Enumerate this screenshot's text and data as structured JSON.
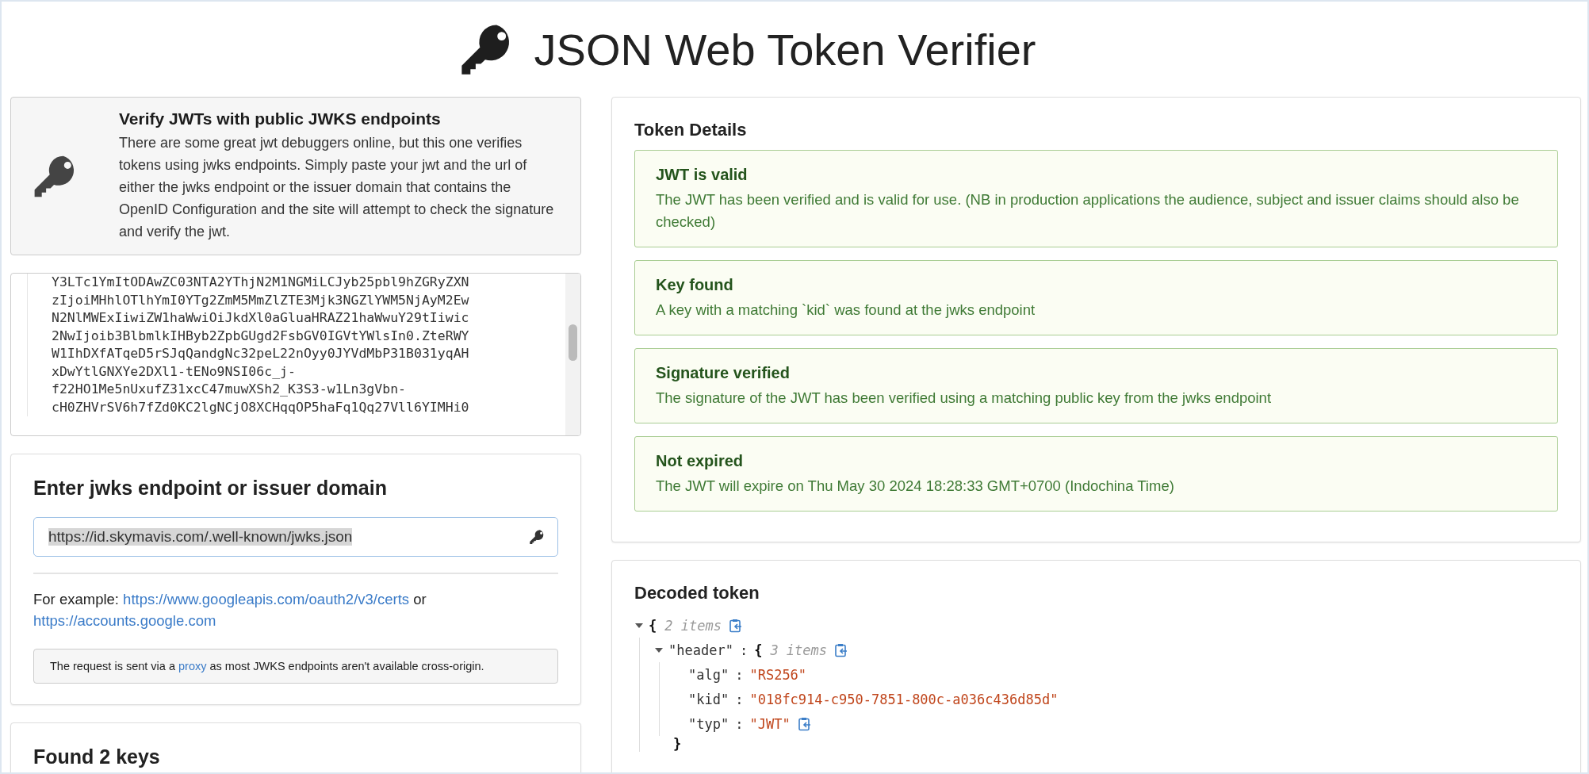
{
  "header": {
    "title": "JSON Web Token Verifier"
  },
  "intro": {
    "title": "Verify JWTs with public JWKS endpoints",
    "text": "There are some great jwt debuggers online, but this one verifies tokens using jwks endpoints. Simply paste your jwt and the url of either the jwks endpoint or the issuer domain that contains the OpenID Configuration and the site will attempt to check the signature and verify the jwt."
  },
  "token_input": {
    "lines": [
      "Y3LTc1YmItODAwZC03NTA2YThjN2M1NGMiLCJyb25pbl9hZGRyZXN",
      "zIjoiMHhlOTlhYmI0YTg2ZmM5MmZlZTE3Mjk3NGZlYWM5NjAyM2Ew",
      "N2NlMWExIiwiZW1haWwiOiJkdXl0aGluaHRAZ21haWwuY29tIiwic",
      "2NwIjoib3BlbmlkIHByb2ZpbGUgd2FsbGV0IGVtYWlsIn0.ZteRWY",
      "W1IhDXfATqeD5rSJqQandgNc32peL22nOyy0JYVdMbP31B031yqAH",
      "xDwYtlGNXYe2DXl1-tENo9NSI06c_j-",
      "f22HO1Me5nUxufZ31xcC47muwXSh2_K3S3-w1Ln3gVbn-",
      "cH0ZHVrSV6h7fZd0KC2lgNCjO8XCHqqOP5haFq1Qq27Vll6YIMHi0"
    ]
  },
  "jwks": {
    "title": "Enter jwks endpoint or issuer domain",
    "value": "https://id.skymavis.com/.well-known/jwks.json",
    "value_selected": true,
    "example": [
      {
        "kind": "text",
        "text": "For example: "
      },
      {
        "kind": "link",
        "text": "https://www.googleapis.com/oauth2/v3/certs"
      },
      {
        "kind": "text",
        "text": " or "
      },
      {
        "kind": "link",
        "text": "https://accounts.google.com"
      }
    ],
    "note": [
      {
        "kind": "text",
        "text": "The request is sent via a "
      },
      {
        "kind": "link",
        "text": "proxy"
      },
      {
        "kind": "text",
        "text": " as most JWKS endpoints aren't available cross-origin."
      }
    ]
  },
  "keys": {
    "title": "Found 2 keys"
  },
  "details": {
    "title": "Token Details",
    "checks": [
      {
        "kind": "success",
        "title": "JWT is valid",
        "text": "The JWT has been verified and is valid for use. (NB in production applications the audience, subject and issuer claims should also be checked)"
      },
      {
        "kind": "success",
        "title": "Key found",
        "text": "A key with a matching `kid` was found at the jwks endpoint"
      },
      {
        "kind": "success",
        "title": "Signature verified",
        "text": "The signature of the JWT has been verified using a matching public key from the jwks endpoint"
      },
      {
        "kind": "success",
        "title": "Not expired",
        "text": "The JWT will expire on Thu May 30 2024 18:28:33 GMT+0700 (Indochina Time)"
      }
    ]
  },
  "decoded": {
    "title": "Decoded token",
    "tree": {
      "expanded": true,
      "open": "{",
      "count": "2 items",
      "copy": true,
      "children": [
        {
          "key": "\"header\"",
          "sep": ":",
          "expanded": true,
          "open": "{",
          "count": "3 items",
          "copy": true,
          "close": "}",
          "children": [
            {
              "key": "\"alg\"",
              "sep": ":",
              "value": "\"RS256\"",
              "copy": false
            },
            {
              "key": "\"kid\"",
              "sep": ":",
              "value": "\"018fc914-c950-7851-800c-a036c436d85d\"",
              "copy": false
            },
            {
              "key": "\"typ\"",
              "sep": ":",
              "value": "\"JWT\"",
              "copy": true
            }
          ]
        }
      ]
    }
  }
}
